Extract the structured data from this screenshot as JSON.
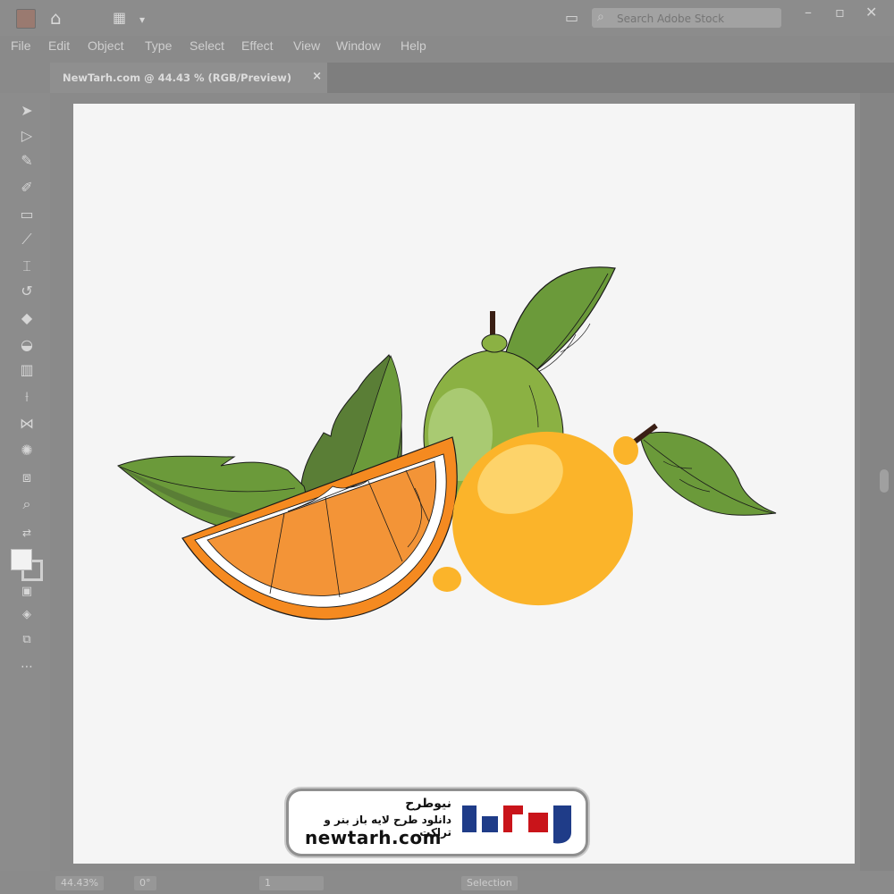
{
  "window": {
    "search_placeholder": "Search Adobe Stock",
    "icons": [
      "app-logo-icon",
      "home-icon",
      "workspace-icon",
      "chevron-down-icon",
      "arrange-icon",
      "search-icon",
      "minimize-icon",
      "restore-icon",
      "close-icon"
    ]
  },
  "menu": {
    "items": [
      "File",
      "Edit",
      "Object",
      "Type",
      "Select",
      "Effect",
      "View",
      "Window",
      "Help"
    ]
  },
  "document_tab": {
    "label": "NewTarh.com @ 44.43 % (RGB/Preview)",
    "close_glyph": "×"
  },
  "tools": [
    "selection-icon",
    "direct-selection-icon",
    "pen-icon",
    "curvature-icon",
    "rectangle-icon",
    "paintbrush-icon",
    "width-icon",
    "rotate-icon",
    "eraser-icon",
    "shape-builder-icon",
    "gradient-icon",
    "eyedropper-icon",
    "blend-icon",
    "symbol-sprayer-icon",
    "artboard-icon",
    "zoom-icon"
  ],
  "status": {
    "zoom": "44.43%",
    "rotation": "0°",
    "artboard_number": "1",
    "tool": "Selection"
  },
  "artwork": {
    "colors": {
      "orange": "#f39437",
      "orange_rind": "#f58a20",
      "lemon": "#fbb42a",
      "lemon_highlight": "#fdd36a",
      "lime": "#8bb143",
      "lime_highlight": "#a9ca72",
      "leaf_light": "#6b9a3a",
      "leaf_dark": "#5a7e36",
      "stem": "#3a1f14"
    }
  },
  "watermark": {
    "name": "نیوطرح",
    "slogan": "دانلود طرح لایه باز بنر و تراکت",
    "domain": "newtarh.com",
    "logo_colors": {
      "primary": "#c9141a",
      "secondary": "#1f3c88"
    }
  }
}
